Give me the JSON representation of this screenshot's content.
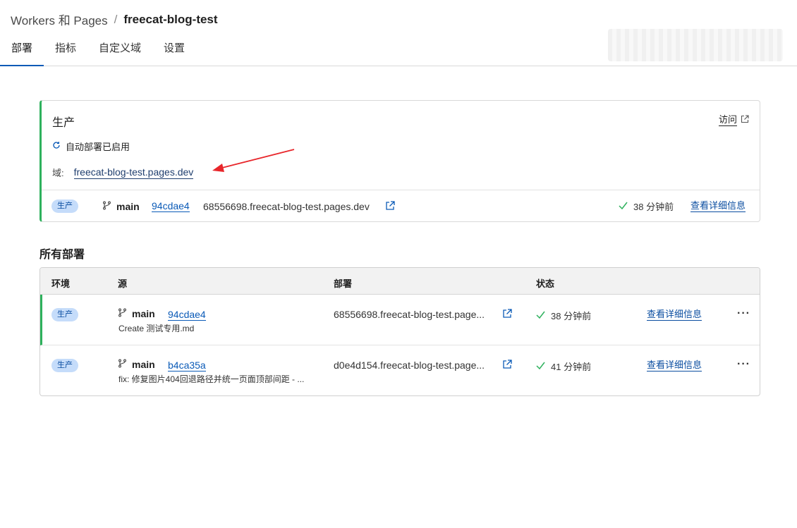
{
  "breadcrumb": {
    "parent": "Workers 和 Pages",
    "separator": "/",
    "current": "freecat-blog-test"
  },
  "tabs": [
    {
      "label": "部署",
      "active": true
    },
    {
      "label": "指标",
      "active": false
    },
    {
      "label": "自定义域",
      "active": false
    },
    {
      "label": "设置",
      "active": false
    }
  ],
  "production": {
    "title": "生产",
    "visit_label": "访问",
    "auto_deploy": "自动部署已启用",
    "domain_label": "域:",
    "domain": "freecat-blog-test.pages.dev",
    "badge": "生产",
    "branch": "main",
    "commit": "94cdae4",
    "deploy_url": "68556698.freecat-blog-test.pages.dev",
    "time": "38 分钟前",
    "details_label": "查看详细信息"
  },
  "all_deployments": {
    "title": "所有部署",
    "headers": [
      "环境",
      "源",
      "部署",
      "状态"
    ],
    "rows": [
      {
        "env": "生产",
        "branch": "main",
        "commit": "94cdae4",
        "message": "Create 测试专用.md",
        "url": "68556698.freecat-blog-test.page...",
        "time": "38 分钟前",
        "details": "查看详细信息",
        "more": "···"
      },
      {
        "env": "生产",
        "branch": "main",
        "commit": "b4ca35a",
        "message": "fix: 修复图片404回退路径并统一页面顶部间距 - ...",
        "url": "d0e4d154.freecat-blog-test.page...",
        "time": "41 分钟前",
        "details": "查看详细信息",
        "more": "···"
      }
    ]
  },
  "colors": {
    "accent": "#0a5ab7",
    "success": "#2eb15d",
    "badge_bg": "#c5dcfa",
    "annotation_arrow": "#e8262b"
  },
  "icons": [
    "external-link-icon",
    "refresh-icon",
    "branch-icon",
    "check-icon",
    "more-icon",
    "arrow-annotation"
  ]
}
